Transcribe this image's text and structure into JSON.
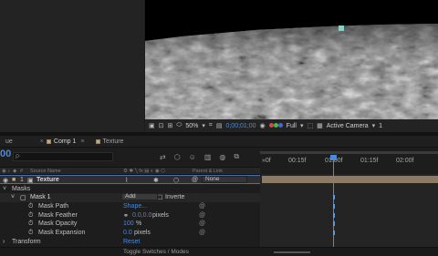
{
  "viewer": {
    "zoom": "50%",
    "timecode": "0;00;01;00",
    "resolution": "Full",
    "camera": "Active Camera",
    "views": "1"
  },
  "tabs": [
    {
      "label": "ue"
    },
    {
      "label": "Comp 1"
    },
    {
      "label": "Texture"
    }
  ],
  "timeline": {
    "current_time": "00",
    "search_placeholder": "ρ·",
    "ruler_ticks": [
      "»0f",
      "00:15f",
      "01:00f",
      "01:15f",
      "02:00f"
    ],
    "column_headers": {
      "source_name": "Source Name",
      "parent": "Parent & Link"
    }
  },
  "layer": {
    "index": "1",
    "name": "Texture",
    "parent": "None"
  },
  "masks": {
    "group_label": "Masks",
    "mask_name": "Mask 1",
    "mode": "Add",
    "inverted": "Inverte",
    "properties": [
      {
        "name": "Mask Path",
        "value": "Shape..."
      },
      {
        "name": "Mask Feather",
        "value": "0.0,0.0",
        "unit": "pixels"
      },
      {
        "name": "Mask Opacity",
        "value": "100",
        "unit": "%"
      },
      {
        "name": "Mask Expansion",
        "value": "0.0",
        "unit": "pixels"
      }
    ]
  },
  "transform": {
    "label": "Transform",
    "reset": "Reset"
  },
  "footer": {
    "toggle": "Toggle Switches / Modes"
  },
  "colors": {
    "accent": "#4a8bd8",
    "layer_bar": "#8c7b62",
    "comp_icon": "#c9a978"
  }
}
